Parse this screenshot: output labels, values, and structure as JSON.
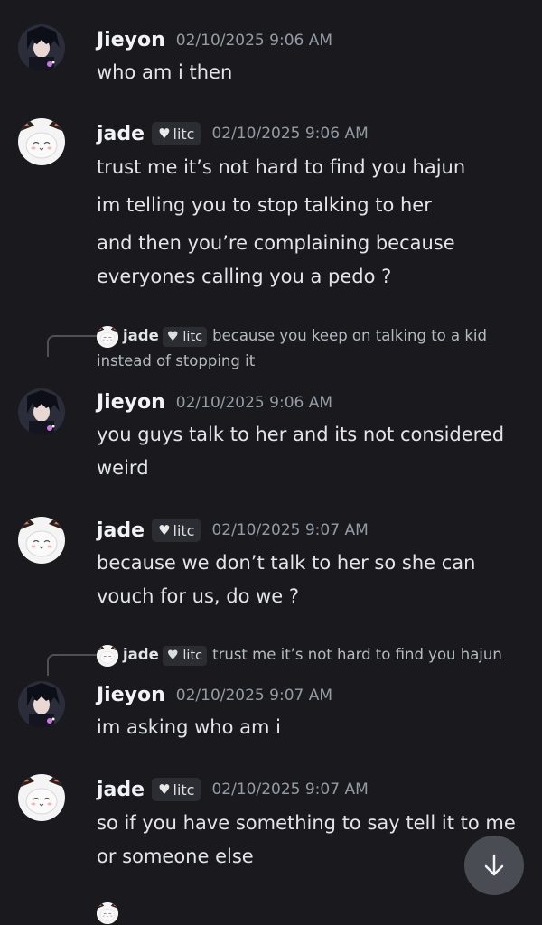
{
  "messages": [
    {
      "author": "Jieyon",
      "timestamp": "02/10/2025 9:06 AM",
      "lines": [
        "who am i then"
      ]
    },
    {
      "author": "jade",
      "tag": "litc",
      "timestamp": "02/10/2025 9:06 AM",
      "lines": [
        "trust me it’s not hard to find you hajun",
        "im telling you to stop talking to her",
        "and then you’re complaining because everyones calling you a pedo ?"
      ]
    },
    {
      "author": "Jieyon",
      "timestamp": "02/10/2025 9:06 AM",
      "reply": {
        "author": "jade",
        "tag": "litc",
        "text": "because you keep on talking to a kid instead of stopping it"
      },
      "lines": [
        "you guys talk to her and its not considered weird"
      ]
    },
    {
      "author": "jade",
      "tag": "litc",
      "timestamp": "02/10/2025 9:07 AM",
      "lines": [
        "because we don’t talk to her so she can vouch for us, do we ?"
      ]
    },
    {
      "author": "Jieyon",
      "timestamp": "02/10/2025 9:07 AM",
      "reply": {
        "author": "jade",
        "tag": "litc",
        "text": "trust me it’s not hard to find you hajun"
      },
      "lines": [
        "im asking who am i"
      ]
    },
    {
      "author": "jade",
      "tag": "litc",
      "timestamp": "02/10/2025 9:07 AM",
      "lines": [
        "so if you have something to say tell it to me or someone else"
      ]
    }
  ],
  "icons": {
    "scroll": "arrow-down-icon",
    "heart": "heart-icon"
  },
  "colors": {
    "background": "#1a1a1e",
    "timestamp": "#949ba4",
    "tag_bg": "#2c2d32"
  }
}
